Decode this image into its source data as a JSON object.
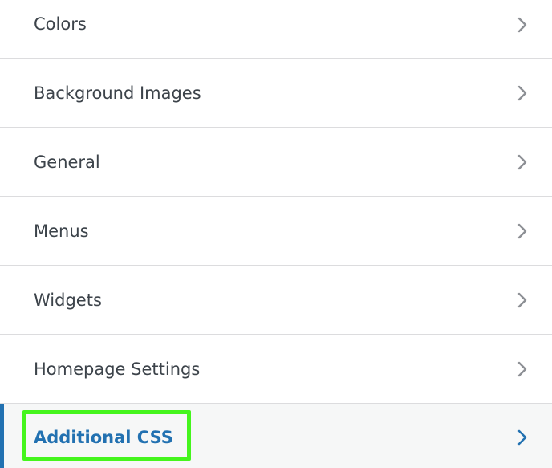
{
  "panel": {
    "items": [
      {
        "label": "Colors"
      },
      {
        "label": "Background Images"
      },
      {
        "label": "General"
      },
      {
        "label": "Menus"
      },
      {
        "label": "Widgets"
      },
      {
        "label": "Homepage Settings"
      },
      {
        "label": "Additional CSS",
        "active": true,
        "highlighted": true
      }
    ]
  },
  "colors": {
    "text": "#3c434a",
    "active_text": "#2271b1",
    "active_bar": "#2271b1",
    "divider": "#dcdcde",
    "active_background": "#f6f7f7",
    "highlight_border": "#45f51d"
  },
  "icons": {
    "chevron": "chevron-right-icon"
  }
}
